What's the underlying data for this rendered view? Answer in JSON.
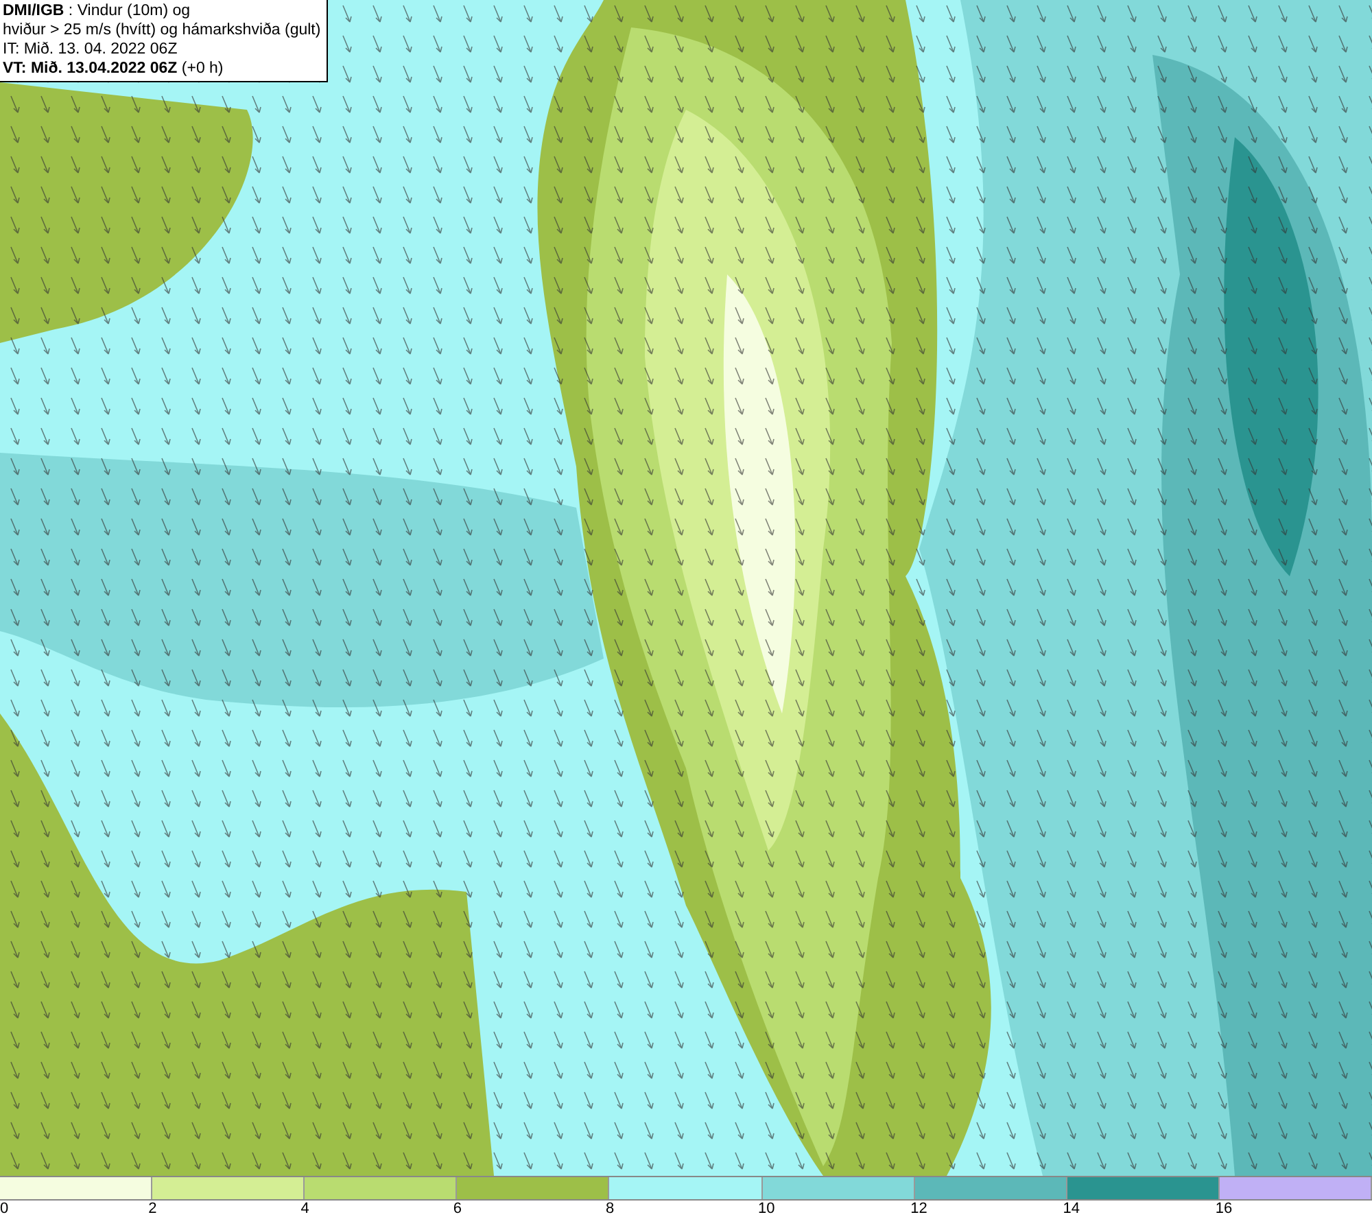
{
  "info_box": {
    "lines": [
      "**DMI/IGB** : Vindur (10m) og",
      "hviður > 25 m/s (hvítt) og hámarkshviða (gult)",
      "IT: Mið. 13. 04. 2022 06Z",
      "**VT: Mið. 13.04.2022 06Z** (+0 h)"
    ]
  },
  "legend": {
    "bins": [
      {
        "color": "#f5fde0"
      },
      {
        "color": "#d4ee94"
      },
      {
        "color": "#b9dc70"
      },
      {
        "color": "#9dbf48"
      },
      {
        "color": "#a5f5f5"
      },
      {
        "color": "#82d9d9"
      },
      {
        "color": "#5cb8b8"
      },
      {
        "color": "#2a9490"
      },
      {
        "color": "#c0b0f5"
      }
    ],
    "ticks": [
      "0",
      "2",
      "4",
      "6",
      "8",
      "10",
      "12",
      "14",
      "16"
    ]
  }
}
